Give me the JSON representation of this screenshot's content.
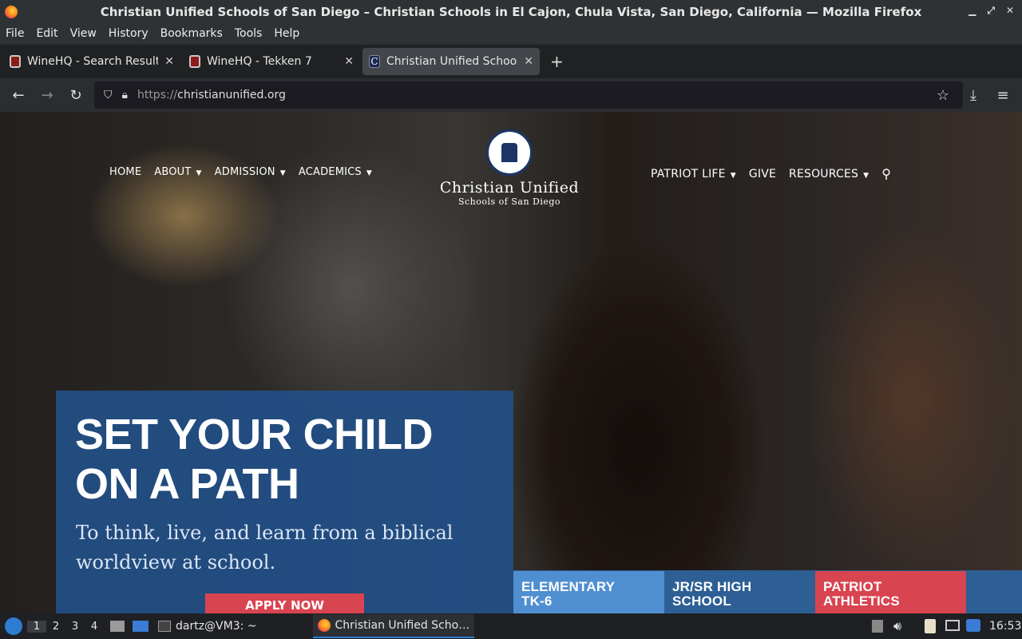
{
  "window": {
    "title": "Christian Unified Schools of San Diego – Christian Schools in El Cajon, Chula Vista, San Diego, California — Mozilla Firefox"
  },
  "menu": [
    "File",
    "Edit",
    "View",
    "History",
    "Bookmarks",
    "Tools",
    "Help"
  ],
  "tabs": [
    {
      "title": "WineHQ - Search Results"
    },
    {
      "title": "WineHQ - Tekken 7"
    },
    {
      "title": "Christian Unified Schools"
    }
  ],
  "address": {
    "protocol": "https://",
    "host": "christianunified.org"
  },
  "site": {
    "nav_left": [
      "HOME",
      "ABOUT",
      "ADMISSION",
      "ACADEMICS"
    ],
    "nav_right": [
      "PATRIOT LIFE",
      "GIVE",
      "RESOURCES"
    ],
    "logo_line1": "Christian Unified",
    "logo_line2": "Schools of San Diego",
    "hero_heading_line1": "SET YOUR CHILD",
    "hero_heading_line2": "ON A PATH",
    "hero_sub": "To think, live, and learn from a biblical worldview at school.",
    "apply_label": "APPLY NOW",
    "cards": [
      {
        "line1": "ELEMENTARY",
        "line2": "TK-6",
        "color": "#4f8fd1"
      },
      {
        "line1": "JR/SR HIGH",
        "line2": "SCHOOL",
        "color": "#2d5f94"
      },
      {
        "line1": "PATRIOT",
        "line2": "ATHLETICS",
        "color": "#d94451"
      }
    ]
  },
  "taskbar": {
    "workspaces": [
      "1",
      "2",
      "3",
      "4"
    ],
    "terminal": "dartz@VM3: ~",
    "firefox": "Christian Unified Scho…",
    "clock": "16:53"
  }
}
